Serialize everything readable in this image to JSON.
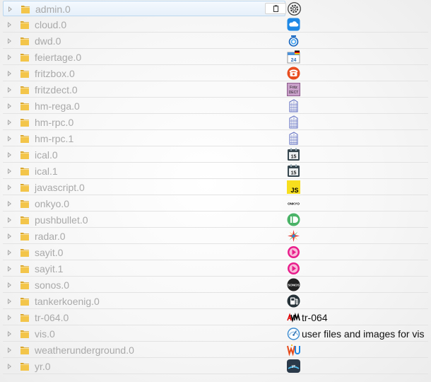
{
  "tree": {
    "items": [
      {
        "name": "admin.0",
        "icon": "gear-icon",
        "label": ""
      },
      {
        "name": "cloud.0",
        "icon": "cloud-icon",
        "label": ""
      },
      {
        "name": "dwd.0",
        "icon": "dwd-weather-icon",
        "label": ""
      },
      {
        "name": "feiertage.0",
        "icon": "calendar-holiday-icon",
        "label": ""
      },
      {
        "name": "fritzbox.0",
        "icon": "phone-icon",
        "label": ""
      },
      {
        "name": "fritzdect.0",
        "icon": "fritz-dect-icon",
        "label": ""
      },
      {
        "name": "hm-rega.0",
        "icon": "homematic-icon",
        "label": ""
      },
      {
        "name": "hm-rpc.0",
        "icon": "homematic-icon",
        "label": ""
      },
      {
        "name": "hm-rpc.1",
        "icon": "homematic-icon",
        "label": ""
      },
      {
        "name": "ical.0",
        "icon": "calendar-15-icon",
        "label": ""
      },
      {
        "name": "ical.1",
        "icon": "calendar-15-icon",
        "label": ""
      },
      {
        "name": "javascript.0",
        "icon": "js-icon",
        "label": ""
      },
      {
        "name": "onkyo.0",
        "icon": "onkyo-logo-icon",
        "label": ""
      },
      {
        "name": "pushbullet.0",
        "icon": "pushbullet-icon",
        "label": ""
      },
      {
        "name": "radar.0",
        "icon": "radar-icon",
        "label": ""
      },
      {
        "name": "sayit.0",
        "icon": "sayit-icon",
        "label": ""
      },
      {
        "name": "sayit.1",
        "icon": "sayit-icon",
        "label": ""
      },
      {
        "name": "sonos.0",
        "icon": "sonos-icon",
        "label": ""
      },
      {
        "name": "tankerkoenig.0",
        "icon": "fuel-pump-icon",
        "label": ""
      },
      {
        "name": "tr-064.0",
        "icon": "avm-logo-icon",
        "label": "tr-064"
      },
      {
        "name": "vis.0",
        "icon": "vis-gauge-icon",
        "label": "user files and images for vis"
      },
      {
        "name": "weatherunderground.0",
        "icon": "weather-underground-icon",
        "label": ""
      },
      {
        "name": "yr.0",
        "icon": "yr-icon",
        "label": ""
      }
    ]
  },
  "colors": {
    "folder": "#f3c54a",
    "item_text": "#a9a9a9",
    "selected_border": "#bcd7ee"
  }
}
